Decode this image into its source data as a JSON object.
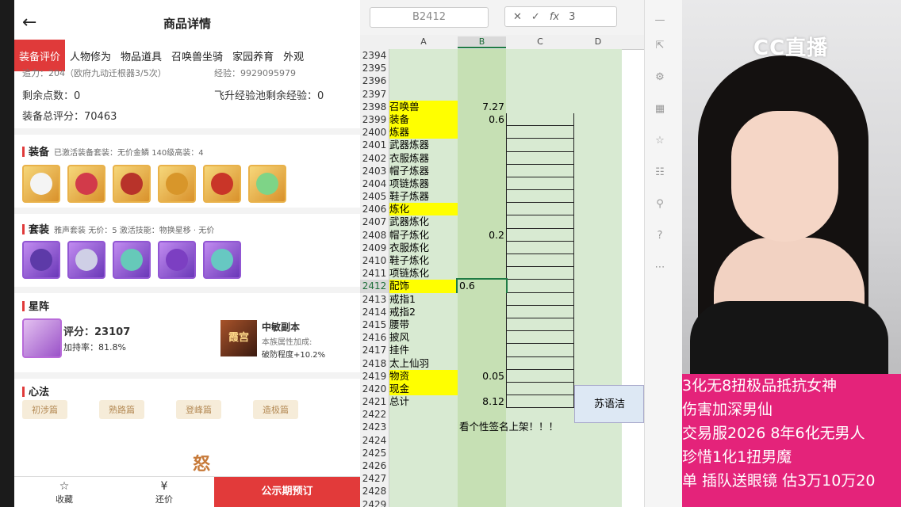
{
  "phone": {
    "title": "商品详情",
    "tabs": [
      "装备评价",
      "人物修为",
      "物品道具",
      "召唤兽坐骑",
      "家园养育",
      "外观"
    ],
    "stats": {
      "partial_top": "追力：204（欧府九动迁根器3/5次）",
      "partial_top_right": "经验：9929095979",
      "remaining_points_label": "剩余点数：",
      "remaining_points": "0",
      "flyup_exp_label": "飞升经验池剩余经验：",
      "flyup_exp": "0",
      "total_score_label": "装备总评分：",
      "total_score": "70463"
    },
    "equipment": {
      "title": "装备",
      "sub": "已激活装备套装：无价金鳞   140级高装：4"
    },
    "suit": {
      "title": "套装",
      "sub": "雅声套装   无价：5   激活技能：物换星移 · 无价"
    },
    "xingzhen": {
      "title": "星阵",
      "score_label": "评分：",
      "score": "23107",
      "bonus_label": "加持率：",
      "bonus": "81.8%",
      "fb_name": "中敏副本",
      "fb_attr": "本族属性加成:",
      "fb_break": "破防程度+10.2%",
      "fb_icon_text": "霞宫"
    },
    "xinfa": {
      "title": "心法",
      "tags": [
        "初涉篇",
        "熟路篇",
        "登峰篇",
        "造极篇"
      ],
      "glyph": "怒"
    },
    "bottom": {
      "fav": "收藏",
      "bargain": "还价",
      "preorder": "公示期预订"
    }
  },
  "excel": {
    "namebox": "B2412",
    "formula_value": "3",
    "columns": [
      "A",
      "B",
      "C",
      "D"
    ],
    "rows": [
      {
        "n": "2394",
        "a": "",
        "b": "",
        "y": false,
        "box": false
      },
      {
        "n": "2395",
        "a": "",
        "b": "",
        "y": false,
        "box": false
      },
      {
        "n": "2396",
        "a": "",
        "b": "",
        "y": false,
        "box": false
      },
      {
        "n": "2397",
        "a": "",
        "b": "",
        "y": false,
        "box": false
      },
      {
        "n": "2398",
        "a": "召唤兽",
        "b": "7.27",
        "y": true,
        "box": false
      },
      {
        "n": "2399",
        "a": "装备",
        "b": "0.6",
        "y": true,
        "box": true
      },
      {
        "n": "2400",
        "a": "炼器",
        "b": "",
        "y": true,
        "box": true
      },
      {
        "n": "2401",
        "a": "武器炼器",
        "b": "",
        "y": false,
        "box": true
      },
      {
        "n": "2402",
        "a": "衣服炼器",
        "b": "",
        "y": false,
        "box": true
      },
      {
        "n": "2403",
        "a": "帽子炼器",
        "b": "",
        "y": false,
        "box": true
      },
      {
        "n": "2404",
        "a": "项链炼器",
        "b": "",
        "y": false,
        "box": true
      },
      {
        "n": "2405",
        "a": "鞋子炼器",
        "b": "",
        "y": false,
        "box": true
      },
      {
        "n": "2406",
        "a": "炼化",
        "b": "",
        "y": true,
        "box": true
      },
      {
        "n": "2407",
        "a": "武器炼化",
        "b": "",
        "y": false,
        "box": true
      },
      {
        "n": "2408",
        "a": "帽子炼化",
        "b": "0.2",
        "y": false,
        "box": true
      },
      {
        "n": "2409",
        "a": "衣服炼化",
        "b": "",
        "y": false,
        "box": true
      },
      {
        "n": "2410",
        "a": "鞋子炼化",
        "b": "",
        "y": false,
        "box": true
      },
      {
        "n": "2411",
        "a": "项链炼化",
        "b": "",
        "y": false,
        "box": true
      },
      {
        "n": "2412",
        "a": "配饰",
        "b": "0.6",
        "y": true,
        "box": true
      },
      {
        "n": "2413",
        "a": "戒指1",
        "b": "",
        "y": false,
        "box": true
      },
      {
        "n": "2414",
        "a": "戒指2",
        "b": "",
        "y": false,
        "box": true
      },
      {
        "n": "2415",
        "a": "腰带",
        "b": "",
        "y": false,
        "box": true
      },
      {
        "n": "2416",
        "a": "披风",
        "b": "",
        "y": false,
        "box": true
      },
      {
        "n": "2417",
        "a": "挂件",
        "b": "",
        "y": false,
        "box": true
      },
      {
        "n": "2418",
        "a": "太上仙羽",
        "b": "",
        "y": false,
        "box": true
      },
      {
        "n": "2419",
        "a": "物资",
        "b": "0.05",
        "y": true,
        "box": true
      },
      {
        "n": "2420",
        "a": "现金",
        "b": "",
        "y": true,
        "box": true
      },
      {
        "n": "2421",
        "a": "总计",
        "b": "8.12",
        "y": false,
        "box": true
      },
      {
        "n": "2422",
        "a": "",
        "b": "",
        "y": false,
        "box": false
      },
      {
        "n": "2423",
        "a": "",
        "b": "看个性签名上架！！！",
        "y": false,
        "box": false
      },
      {
        "n": "2424",
        "a": "",
        "b": "",
        "y": false,
        "box": false
      },
      {
        "n": "2425",
        "a": "",
        "b": "",
        "y": false,
        "box": false
      },
      {
        "n": "2426",
        "a": "",
        "b": "",
        "y": false,
        "box": false
      },
      {
        "n": "2427",
        "a": "",
        "b": "",
        "y": false,
        "box": false
      },
      {
        "n": "2428",
        "a": "",
        "b": "",
        "y": false,
        "box": false
      },
      {
        "n": "2429",
        "a": "",
        "b": "",
        "y": false,
        "box": false
      }
    ],
    "selected_row": "2412",
    "d_note": "苏语洁"
  },
  "stream": {
    "logo": "CC直播",
    "chat": [
      "3化无8扭极品抵抗女神",
      "伤害加深男仙",
      "交易服2026 8年6化无男人",
      "珍惜1化1扭男魔",
      "单 插队送眼镜 估3万10万20"
    ],
    "colors": {
      "chat_bg": "#e4237a",
      "accent": "#e03a3a",
      "excel_green": "#c6e0b4"
    }
  }
}
